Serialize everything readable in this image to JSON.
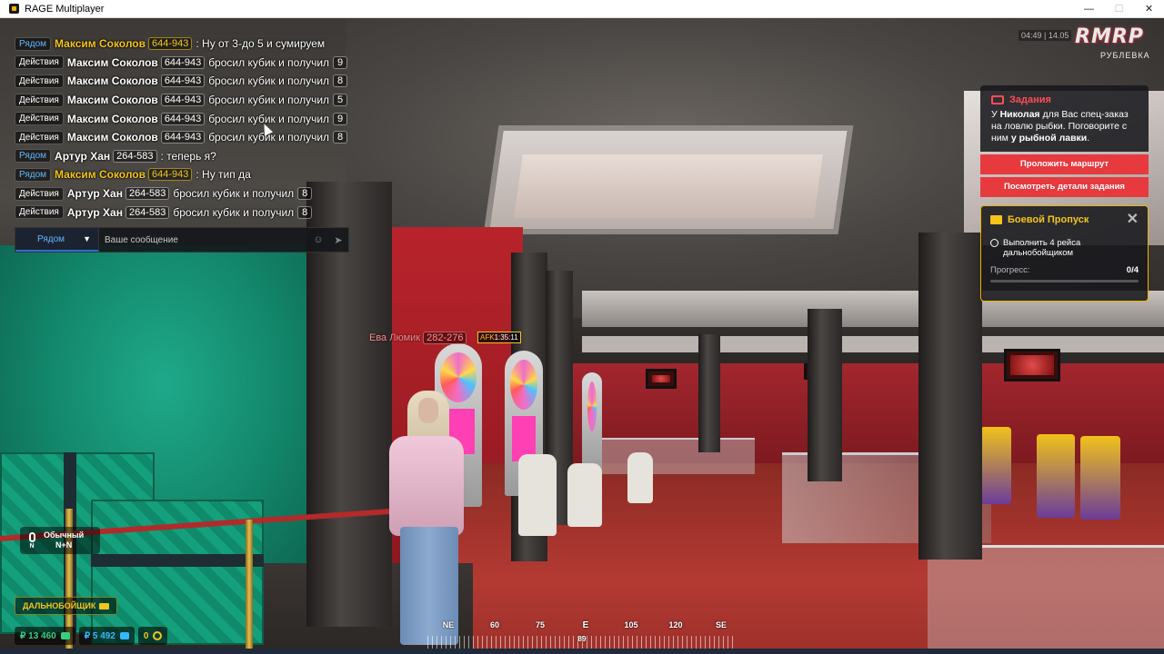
{
  "window": {
    "title": "RAGE Multiplayer",
    "controls": [
      "—",
      "☐",
      "✕"
    ]
  },
  "chat": {
    "messages": [
      {
        "channel": "Рядом",
        "kind": "local",
        "name": "Максим Соколов",
        "id": "644-943",
        "text": ": Ну от 3-до 5 и сумируем",
        "dice": ""
      },
      {
        "channel": "Действия",
        "kind": "action",
        "name": "Максим Соколов",
        "id": "644-943",
        "text": "бросил кубик и получил",
        "dice": "9"
      },
      {
        "channel": "Действия",
        "kind": "action",
        "name": "Максим Соколов",
        "id": "644-943",
        "text": "бросил кубик и получил",
        "dice": "8"
      },
      {
        "channel": "Действия",
        "kind": "action",
        "name": "Максим Соколов",
        "id": "644-943",
        "text": "бросил кубик и получил",
        "dice": "5"
      },
      {
        "channel": "Действия",
        "kind": "action",
        "name": "Максим Соколов",
        "id": "644-943",
        "text": "бросил кубик и получил",
        "dice": "9"
      },
      {
        "channel": "Действия",
        "kind": "action",
        "name": "Максим Соколов",
        "id": "644-943",
        "text": "бросил кубик и получил",
        "dice": "8"
      },
      {
        "channel": "Рядом",
        "kind": "local-white",
        "name": "Артур Хан",
        "id": "264-583",
        "text": ": теперь я?",
        "dice": ""
      },
      {
        "channel": "Рядом",
        "kind": "local",
        "name": "Максим Соколов",
        "id": "644-943",
        "text": ": Ну тип да",
        "dice": ""
      },
      {
        "channel": "Действия",
        "kind": "action",
        "name": "Артур Хан",
        "id": "264-583",
        "text": "бросил кубик и получил",
        "dice": "8"
      },
      {
        "channel": "Действия",
        "kind": "action",
        "name": "Артур Хан",
        "id": "264-583",
        "text": "бросил кубик и получил",
        "dice": "8"
      }
    ],
    "input": {
      "channel": "Рядом",
      "placeholder": "Ваше сообщение",
      "value": ""
    }
  },
  "hud": {
    "clock": "04:49 | 14.05",
    "logo": "RMRP",
    "server": "РУБЛЕВКА"
  },
  "tasks": {
    "title": "Задания",
    "text_parts": [
      "У ",
      "Николая",
      " для Вас спец-заказ на ловлю рыбки. Поговорите с ним ",
      "у рыбной лавки",
      "."
    ],
    "button_route": "Проложить маршрут",
    "button_details": "Посмотреть детали задания"
  },
  "battle_pass": {
    "title": "Боевой Пропуск",
    "item": "Выполнить 4 рейса дальнобойщиком",
    "progress_label": "Прогресс:",
    "progress_value": "0/4",
    "progress_fraction": 0
  },
  "player_tag": {
    "name": "Ева Люмик",
    "id": "282-276",
    "afk_label": "AFK",
    "afk_time": "1:35:11"
  },
  "voice": {
    "key": "N",
    "mode": "Обычный",
    "binding": "N+N"
  },
  "job": {
    "label": "ДАЛЬНОБОЙЩИК",
    "icon": "truck-icon"
  },
  "money": {
    "cash": "₽ 13 460",
    "bank": "₽ 5 492",
    "coins": "0"
  },
  "compass": {
    "labels": [
      "NE",
      "60",
      "75",
      "E",
      "105",
      "120",
      "SE"
    ],
    "heading": "89"
  },
  "colors": {
    "accent_red": "#e63a3f",
    "accent_yellow": "#f5c518",
    "local_channel": "#5fb6ff"
  }
}
